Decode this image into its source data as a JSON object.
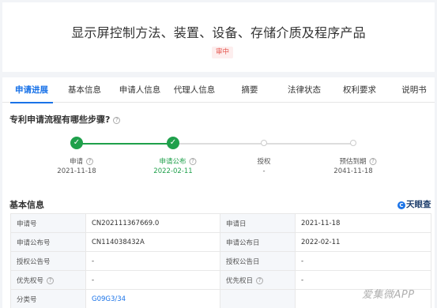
{
  "header": {
    "title": "显示屏控制方法、装置、设备、存储介质及程序产品",
    "status_badge": "审中"
  },
  "tabs": [
    {
      "label": "申请进展",
      "active": true
    },
    {
      "label": "基本信息",
      "active": false
    },
    {
      "label": "申请人信息",
      "active": false
    },
    {
      "label": "代理人信息",
      "active": false
    },
    {
      "label": "摘要",
      "active": false
    },
    {
      "label": "法律状态",
      "active": false
    },
    {
      "label": "权利要求",
      "active": false
    },
    {
      "label": "说明书",
      "active": false
    }
  ],
  "progress": {
    "title": "专利申请流程有哪些步骤?",
    "help_icon": "question-circle-icon",
    "steps": [
      {
        "label": "申请",
        "date": "2021-11-18",
        "done": true
      },
      {
        "label": "申请公布",
        "date": "2022-02-11",
        "done": true,
        "current": true
      },
      {
        "label": "授权",
        "date": "-",
        "done": false
      },
      {
        "label": "预估到期",
        "date": "2041-11-18",
        "done": false
      }
    ]
  },
  "basic_info": {
    "title": "基本信息",
    "brand": "天眼查",
    "rows": [
      {
        "l1": "申请号",
        "v1": "CN202111367669.0",
        "l2": "申请日",
        "v2": "2021-11-18"
      },
      {
        "l1": "申请公布号",
        "v1": "CN114038432A",
        "l2": "申请公布日",
        "v2": "2022-02-11"
      },
      {
        "l1": "授权公告号",
        "v1": "-",
        "l2": "授权公告日",
        "v2": "-"
      },
      {
        "l1": "优先权号",
        "v1": "-",
        "l2": "优先权日",
        "v2": "-"
      },
      {
        "l1": "分类号",
        "v1": "G09G3/34",
        "l2": "",
        "v2": ""
      }
    ]
  },
  "watermark": "爱集微APP",
  "colors": {
    "accent": "#1a73e8",
    "success": "#1fa04b",
    "badge": "#e5534b"
  }
}
